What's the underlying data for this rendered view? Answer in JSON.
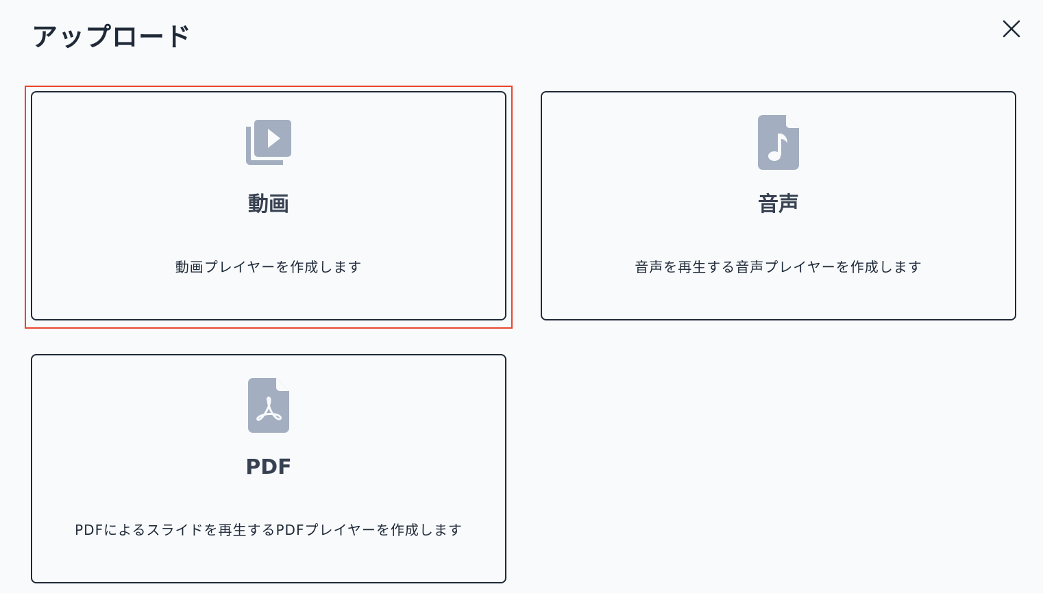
{
  "dialog": {
    "title": "アップロード",
    "close_icon": "close-icon"
  },
  "colors": {
    "icon_gray": "#a3aec0",
    "border": "#1f2937",
    "highlight": "#e8452f",
    "background": "#f8fafc"
  },
  "cards": [
    {
      "icon": "video-library-icon",
      "title": "動画",
      "description": "動画プレイヤーを作成します"
    },
    {
      "icon": "audio-file-icon",
      "title": "音声",
      "description": "音声を再生する音声プレイヤーを作成します"
    },
    {
      "icon": "pdf-file-icon",
      "title": "PDF",
      "description": "PDFによるスライドを再生するPDFプレイヤーを作成します"
    }
  ]
}
